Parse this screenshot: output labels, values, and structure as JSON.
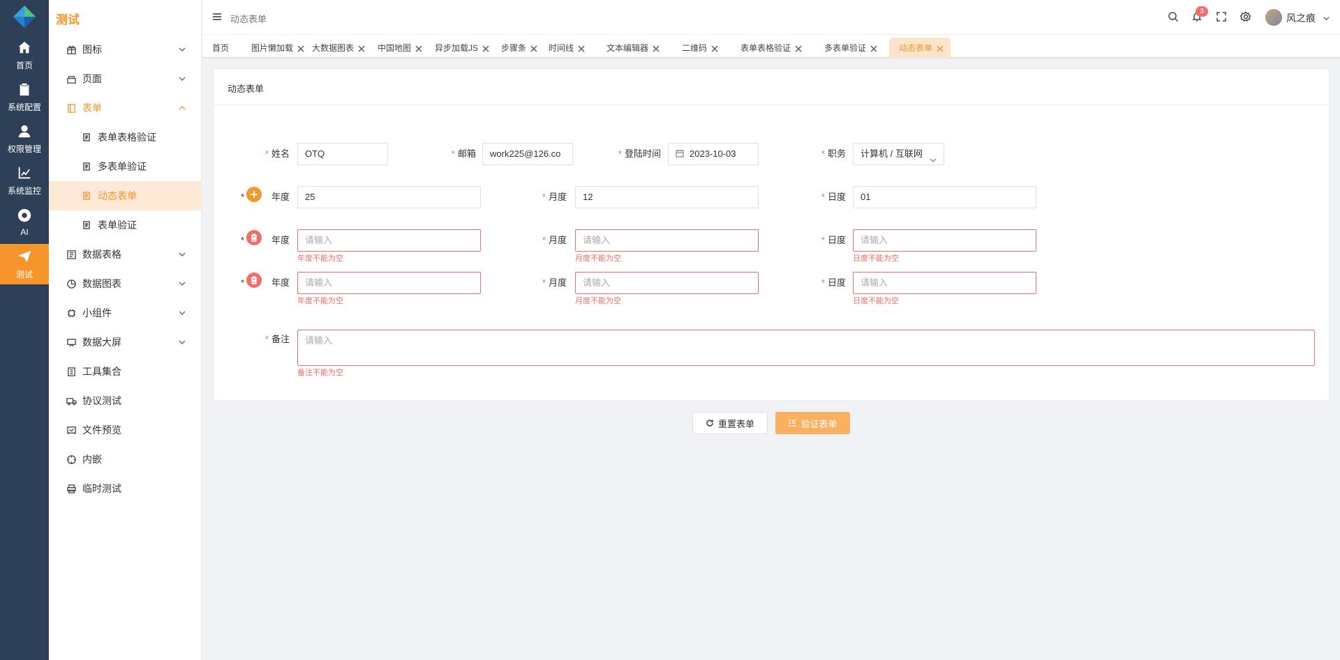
{
  "rail": {
    "items": [
      {
        "label": "首页",
        "icon": "home-icon"
      },
      {
        "label": "系统配置",
        "icon": "clipboard-icon"
      },
      {
        "label": "权限管理",
        "icon": "user-icon"
      },
      {
        "label": "系统监控",
        "icon": "chart-line-icon"
      },
      {
        "label": "AI",
        "icon": "chrome-icon"
      },
      {
        "label": "测试",
        "icon": "send-icon",
        "active": true
      }
    ]
  },
  "sidebar": {
    "title": "测试",
    "items": [
      {
        "label": "图标",
        "icon": "gift-icon"
      },
      {
        "label": "页面",
        "icon": "layers-icon"
      },
      {
        "label": "表单",
        "icon": "form-icon"
      },
      {
        "label": "表单表格验证",
        "icon": "doc-icon"
      },
      {
        "label": "多表单验证",
        "icon": "doc-icon"
      },
      {
        "label": "动态表单",
        "icon": "doc-icon"
      },
      {
        "label": "表单验证",
        "icon": "doc-icon"
      },
      {
        "label": "数据表格",
        "icon": "table-icon"
      },
      {
        "label": "数据图表",
        "icon": "pie-icon"
      },
      {
        "label": "小组件",
        "icon": "cpu-icon"
      },
      {
        "label": "数据大屏",
        "icon": "monitor-icon"
      },
      {
        "label": "工具集合",
        "icon": "book-icon"
      },
      {
        "label": "协议测试",
        "icon": "truck-icon"
      },
      {
        "label": "文件预览",
        "icon": "frame-icon"
      },
      {
        "label": "内嵌",
        "icon": "compass-icon"
      },
      {
        "label": "临时测试",
        "icon": "printer-icon"
      }
    ]
  },
  "header": {
    "breadcrumb": "动态表单",
    "notification_count": "3",
    "username": "风之痕"
  },
  "tabs": [
    "首页",
    "图片懒加载",
    "大数据图表",
    "中国地图",
    "异步加载JS",
    "步骤条",
    "时间线",
    "文本编辑器",
    "二维码",
    "表单表格验证",
    "多表单验证",
    "动态表单"
  ],
  "form": {
    "card_title": "动态表单",
    "name_label": "姓名",
    "name_value": "OTQ",
    "email_label": "邮箱",
    "email_value": "work225@126.co",
    "login_label": "登陆时间",
    "login_value": "2023-10-03",
    "job_label": "职务",
    "job_value": "计算机 / 互联网",
    "year_label": "年度",
    "month_label": "月度",
    "day_label": "日度",
    "row1": {
      "year": "25",
      "month": "12",
      "day": "01"
    },
    "placeholder": "请输入",
    "year_error": "年度不能为空",
    "month_error": "月度不能为空",
    "day_error": "日度不能为空",
    "remark_label": "备注",
    "remark_error": "备注不能为空",
    "required_mark": "*"
  },
  "buttons": {
    "reset": "重置表单",
    "submit": "验证表单"
  },
  "colors": {
    "accent": "#f7952d",
    "rail_bg": "#2e4058",
    "error": "#f56c6c"
  }
}
